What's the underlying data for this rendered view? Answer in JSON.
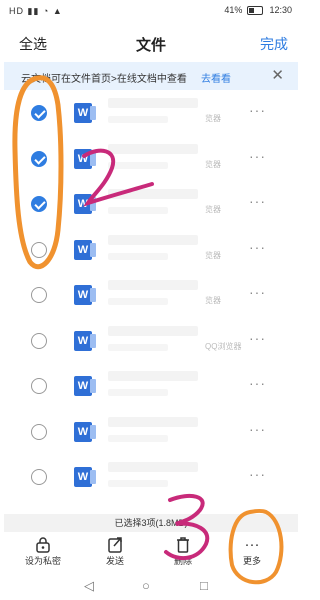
{
  "status": {
    "left": "HD ▮▮ ◔ ▲",
    "battery": "41%",
    "time": "12:30"
  },
  "header": {
    "select_all": "全选",
    "title": "文件",
    "done": "完成"
  },
  "banner": {
    "text": "云文档可在文件首页>在线文档中查看",
    "link": "去看看",
    "close": "✕"
  },
  "files": [
    {
      "checked": true,
      "app": "览器"
    },
    {
      "checked": true,
      "app": "览器"
    },
    {
      "checked": true,
      "app": "览器"
    },
    {
      "checked": false,
      "app": "览器"
    },
    {
      "checked": false,
      "app": "览器"
    },
    {
      "checked": false,
      "app": "QQ浏览器"
    },
    {
      "checked": false,
      "app": ""
    },
    {
      "checked": false,
      "app": ""
    },
    {
      "checked": false,
      "app": ""
    }
  ],
  "icons": {
    "file": "W",
    "more": "···"
  },
  "selection": "已选择3项(1.8MB)",
  "toolbar": {
    "private": "设为私密",
    "send": "发送",
    "delete": "删除",
    "more": "更多"
  },
  "annotation_labels": {
    "two": "2",
    "three": "3"
  },
  "colors": {
    "accent": "#2f7de1",
    "annotation_orange": "#f0922f",
    "annotation_pink": "#c82a7a"
  }
}
